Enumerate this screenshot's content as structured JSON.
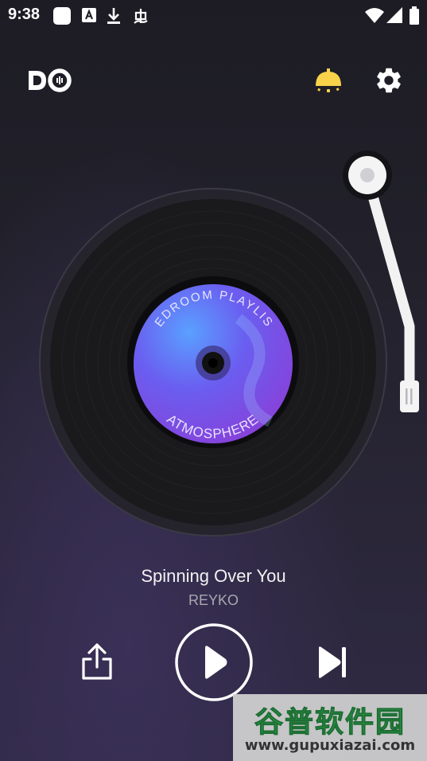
{
  "status_bar": {
    "time": "9:38",
    "icons": [
      "app-square-icon",
      "keyboard-a-icon",
      "download-icon",
      "bug-icon",
      "wifi-icon",
      "signal-icon",
      "battery-icon"
    ]
  },
  "header": {
    "logo_text": "DO",
    "lamp_icon": "lamp-icon",
    "settings_icon": "gear-icon"
  },
  "record": {
    "label_top": "BEDROOM PLAYLIST",
    "label_bottom": "ATMOSPHERE"
  },
  "track": {
    "title": "Spinning Over You",
    "artist": "REYKO"
  },
  "controls": {
    "share_icon": "share-icon",
    "play_icon": "play-icon",
    "next_icon": "skip-next-icon"
  },
  "watermark": {
    "title": "谷普软件园",
    "url": "www.gupuxiazai.com"
  },
  "colors": {
    "accent_yellow": "#f8d24a",
    "label_purple": "#7b4fe0",
    "label_blue": "#4a7cf0"
  }
}
